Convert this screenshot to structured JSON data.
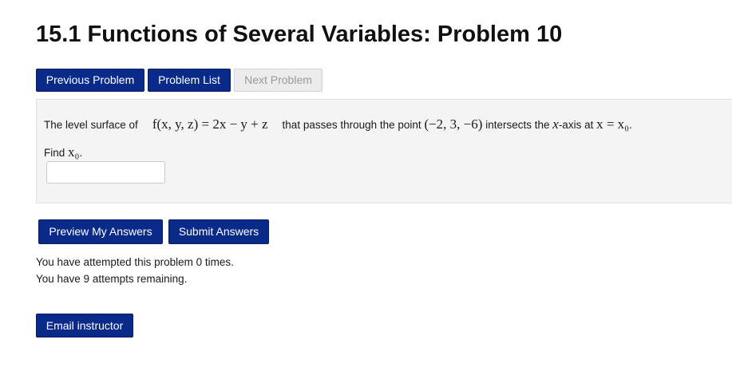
{
  "page": {
    "title": "15.1 Functions of Several Variables: Problem 10"
  },
  "nav": {
    "previous_label": "Previous Problem",
    "list_label": "Problem List",
    "next_label": "Next Problem"
  },
  "problem": {
    "text_before_function": "The level surface of",
    "function_expression": "f(x, y, z) = 2x − y + z",
    "text_before_point": "that passes through the point",
    "point": "(−2, 3, −6)",
    "text_intersects": "intersects the",
    "axis_var": "x",
    "text_axis_at": "-axis at",
    "intersection": "x = x₀",
    "find_label": "Find",
    "find_var": "x₀",
    "answer_value": ""
  },
  "actions": {
    "preview_label": "Preview My Answers",
    "submit_label": "Submit Answers"
  },
  "status": {
    "attempts_line": "You have attempted this problem 0 times.",
    "remaining_line": "You have 9 attempts remaining."
  },
  "footer": {
    "email_label": "Email instructor"
  },
  "colors": {
    "button_primary": "#0a2a8a",
    "button_disabled": "#ececec",
    "problem_background": "#f4f4f4"
  }
}
